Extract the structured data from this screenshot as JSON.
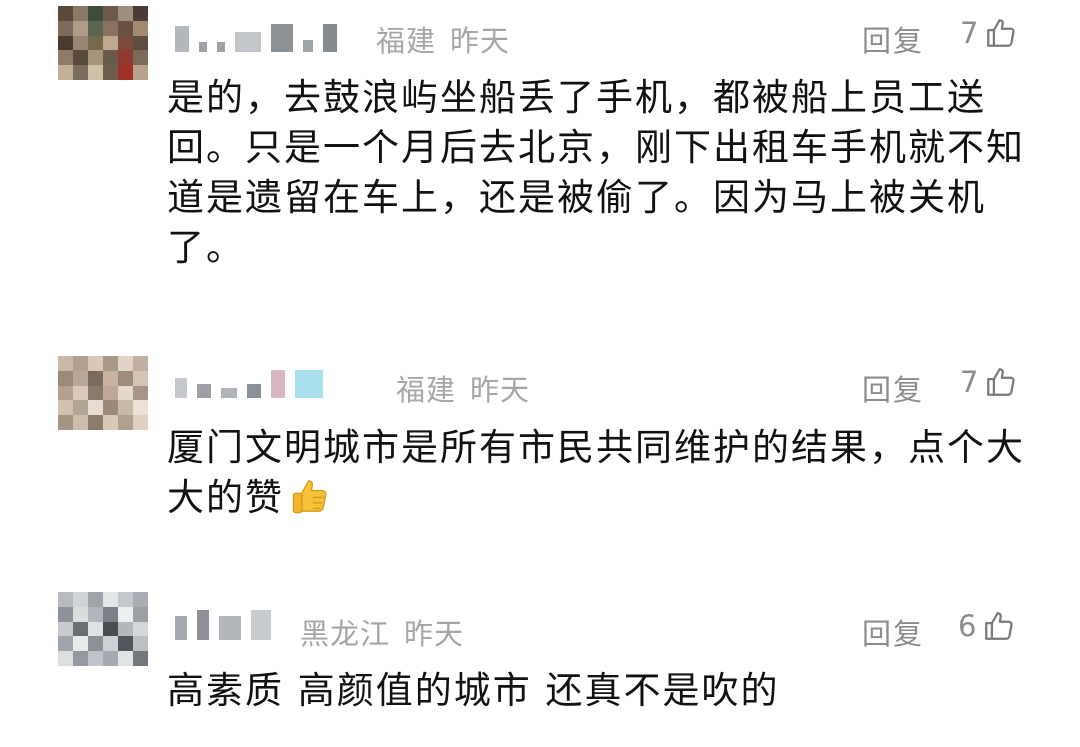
{
  "comments": [
    {
      "region": "福建",
      "time": "昨天",
      "reply_label": "回复",
      "likes": "7",
      "text": "是的，去鼓浪屿坐船丢了手机，都被船上员工送回。只是一个月后去北京，刚下出租车手机就不知道是遗留在车上，还是被偷了。因为马上被关机了。"
    },
    {
      "region": "福建",
      "time": "昨天",
      "reply_label": "回复",
      "likes": "7",
      "text": "厦门文明城市是所有市民共同维护的结果，点个大大的赞",
      "emoji": "thumbs-up-emoji"
    },
    {
      "region": "黑龙江",
      "time": "昨天",
      "reply_label": "回复",
      "likes": "6",
      "text": "高素质 高颜值的城市 还真不是吹的"
    }
  ],
  "icons": {
    "like": "thumbs-up-outline-icon"
  },
  "colors": {
    "meta": "#a6a6a6",
    "text": "#111111",
    "action": "#8c8c8c"
  }
}
